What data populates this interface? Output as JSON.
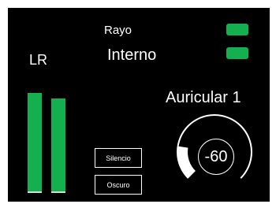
{
  "meter": {
    "label": "LR",
    "channels": [
      {
        "name": "L",
        "level": 0.7
      },
      {
        "name": "R",
        "level": 0.66
      }
    ],
    "color": "#14b050"
  },
  "source": {
    "label": "Rayo",
    "mode": "Interno"
  },
  "indicators": {
    "color": "#14b050",
    "count": 2
  },
  "buttons": {
    "mute_label": "Silencio",
    "dark_label": "Oscuro"
  },
  "output": {
    "label": "Auricular 1",
    "value": "-60",
    "level": 0.2
  }
}
